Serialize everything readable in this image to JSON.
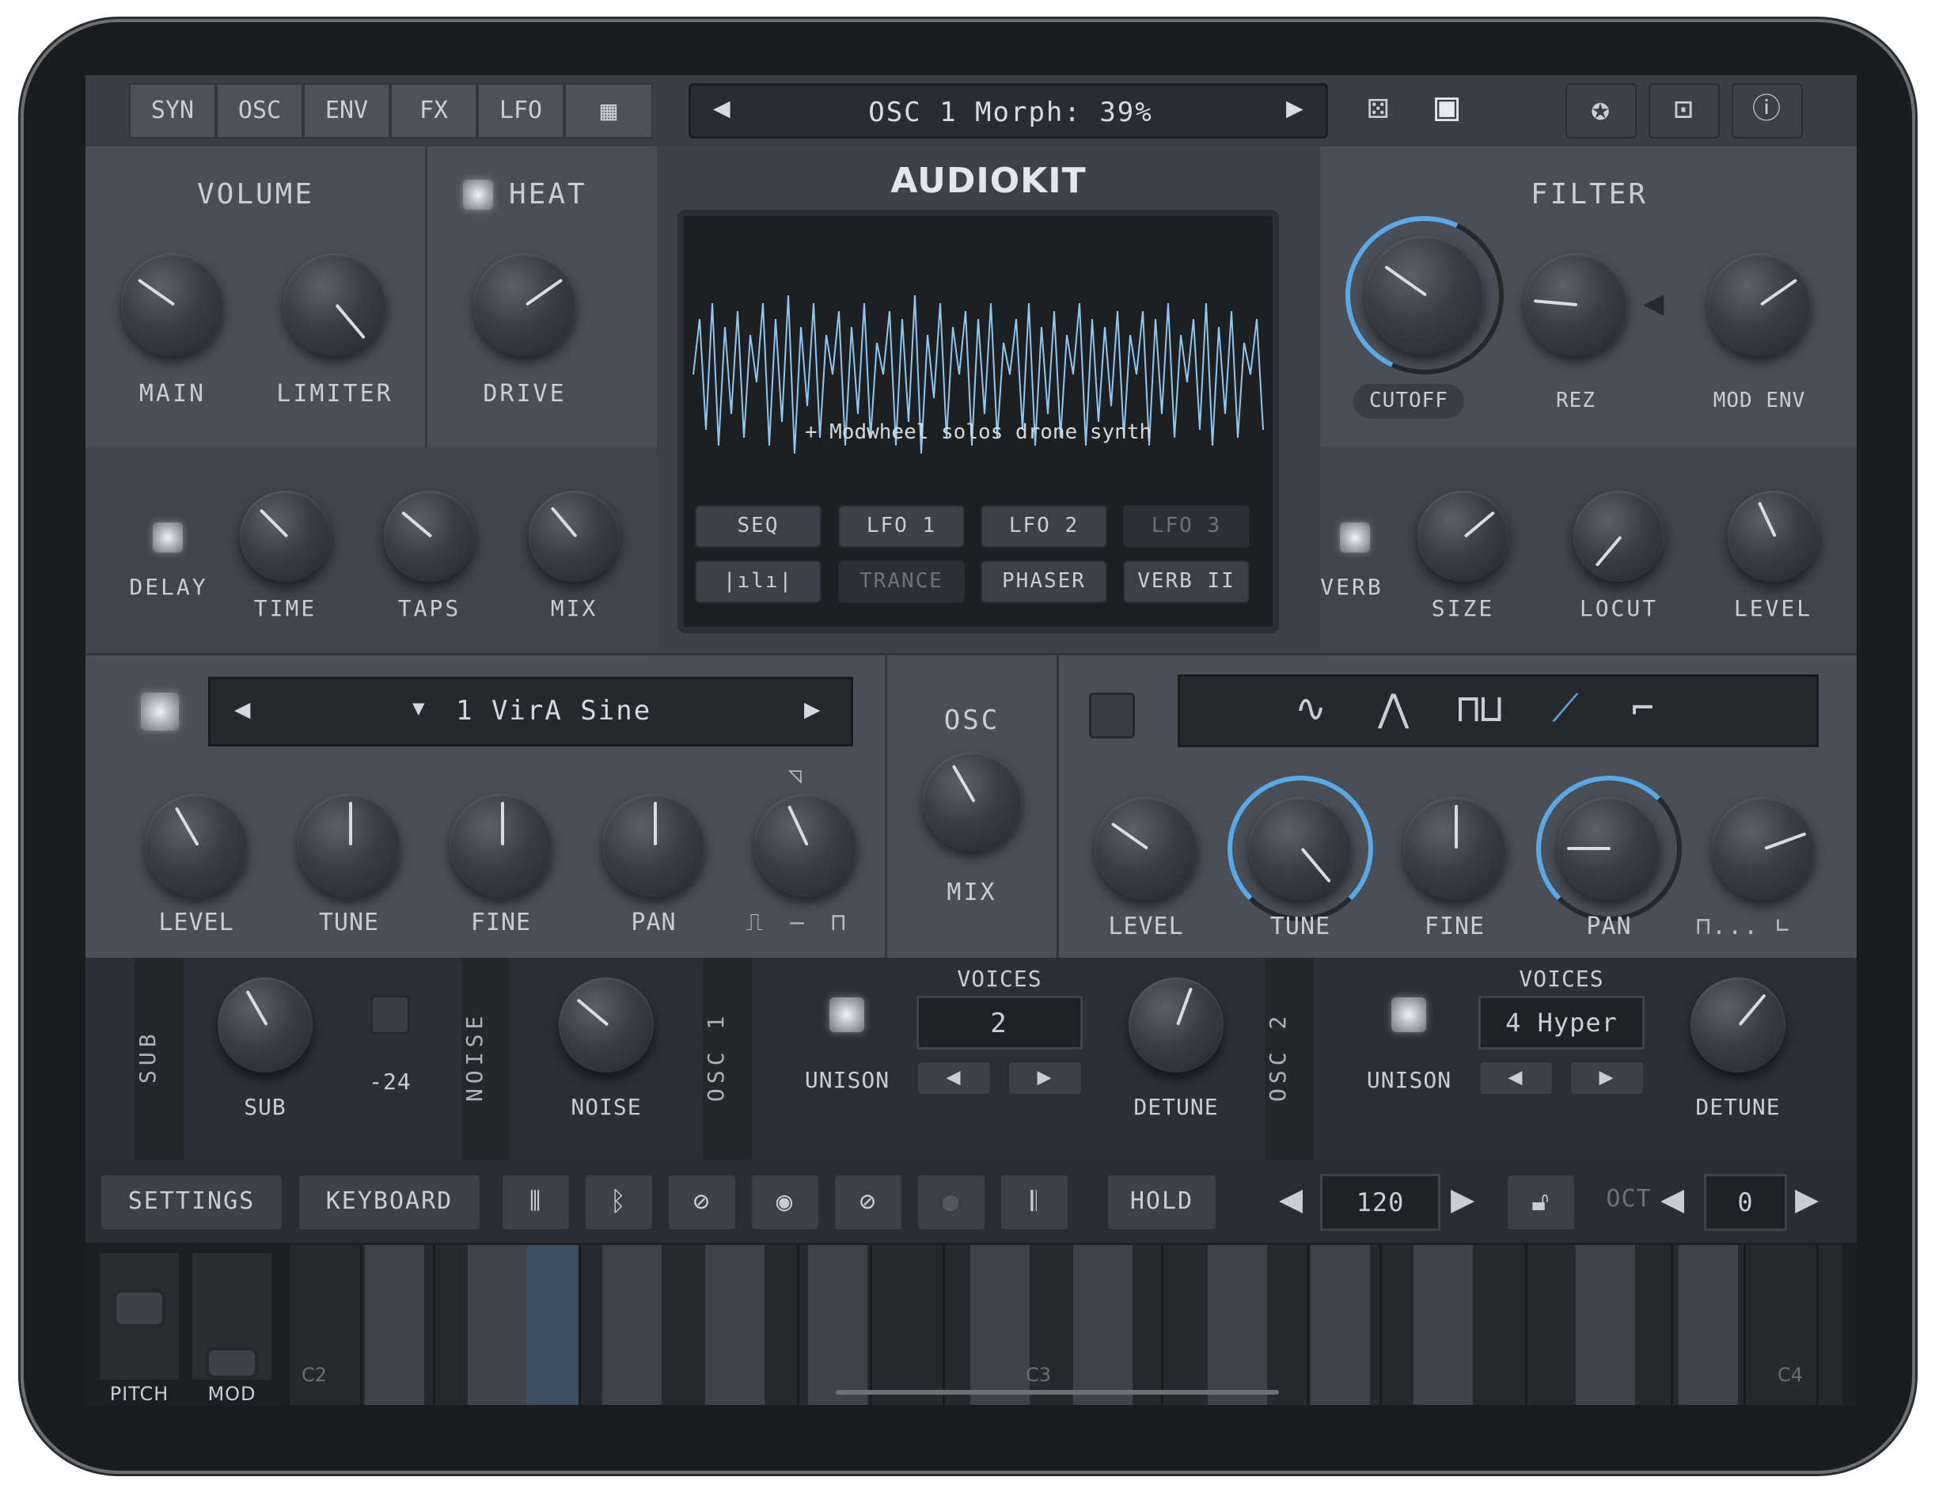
{
  "top_tabs": [
    "SYN",
    "OSC",
    "ENV",
    "FX",
    "LFO"
  ],
  "top_display": "OSC 1 Morph: 39%",
  "volume": {
    "title": "VOLUME",
    "main": "MAIN",
    "limiter": "LIMITER"
  },
  "heat": {
    "title": "HEAT",
    "drive": "DRIVE"
  },
  "logo": "AUDIOKIT",
  "preset_text": "+ Modwheel solos drone synth",
  "screen_buttons": [
    "SEQ",
    "LFO 1",
    "LFO 2",
    "LFO 3",
    "TRANCE",
    "PHASER",
    "VERB II"
  ],
  "filter": {
    "title": "FILTER",
    "cutoff": "CUTOFF",
    "rez": "REZ",
    "mod_env": "MOD ENV"
  },
  "delay": {
    "label": "DELAY",
    "time": "TIME",
    "taps": "TAPS",
    "mix": "MIX"
  },
  "verb": {
    "label": "VERB",
    "size": "SIZE",
    "locut": "LOCUT",
    "level": "LEVEL"
  },
  "osc1": {
    "wave": "1 VirA Sine",
    "level": "LEVEL",
    "tune": "TUNE",
    "fine": "FINE",
    "pan": "PAN"
  },
  "osc_mix": {
    "title": "OSC",
    "mix": "MIX"
  },
  "osc2": {
    "level": "LEVEL",
    "tune": "TUNE",
    "fine": "FINE",
    "pan": "PAN"
  },
  "sub": {
    "side": "SUB",
    "sub": "SUB",
    "octave": "-24"
  },
  "noise": {
    "side": "NOISE",
    "noise": "NOISE"
  },
  "osc1_voices": {
    "side": "OSC 1",
    "unison": "UNISON",
    "voices_title": "VOICES",
    "voices": "2",
    "detune": "DETUNE"
  },
  "osc2_voices": {
    "side": "OSC 2",
    "unison": "UNISON",
    "voices_title": "VOICES",
    "voices": "4 Hyper",
    "detune": "DETUNE"
  },
  "toolbar": {
    "settings": "SETTINGS",
    "keyboard": "KEYBOARD",
    "hold": "HOLD",
    "tempo": "120",
    "oct_label": "OCT",
    "oct": "0"
  },
  "keyboard": {
    "pitch": "PITCH",
    "mod": "MOD",
    "c2": "C2",
    "c3": "C3",
    "c4": "C4"
  },
  "colors": {
    "accent": "#5aa9e6",
    "panel": "#4a4f57",
    "screen": "#1d1f23"
  }
}
